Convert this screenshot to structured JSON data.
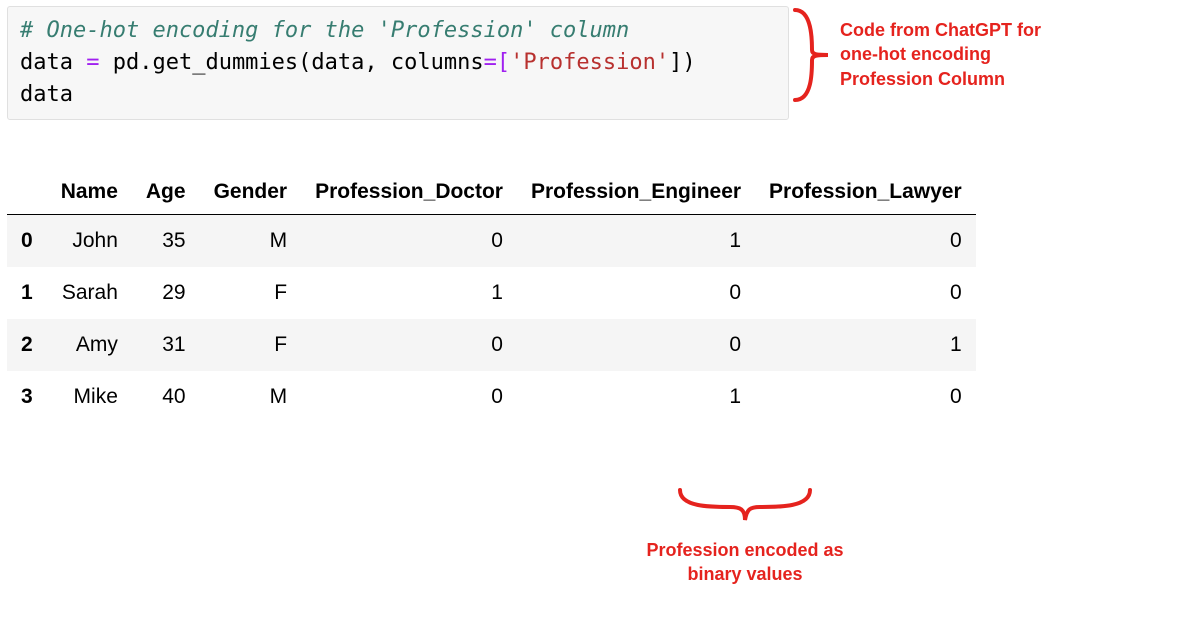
{
  "code": {
    "comment": "# One-hot encoding for the 'Profession' column",
    "line2_id": "data",
    "line2_eq": " = ",
    "line2_call": "pd.get_dummies",
    "line2_lp": "(",
    "line2_arg1": "data",
    "line2_comma": ", ",
    "line2_kw": "columns",
    "line2_eq2": "=[",
    "line2_str": "'Profession'",
    "line2_rp": "])",
    "line3": "data"
  },
  "table": {
    "index_label": "",
    "columns": [
      "Name",
      "Age",
      "Gender",
      "Profession_Doctor",
      "Profession_Engineer",
      "Profession_Lawyer"
    ],
    "rows": [
      {
        "idx": "0",
        "Name": "John",
        "Age": "35",
        "Gender": "M",
        "Profession_Doctor": "0",
        "Profession_Engineer": "1",
        "Profession_Lawyer": "0"
      },
      {
        "idx": "1",
        "Name": "Sarah",
        "Age": "29",
        "Gender": "F",
        "Profession_Doctor": "1",
        "Profession_Engineer": "0",
        "Profession_Lawyer": "0"
      },
      {
        "idx": "2",
        "Name": "Amy",
        "Age": "31",
        "Gender": "F",
        "Profession_Doctor": "0",
        "Profession_Engineer": "0",
        "Profession_Lawyer": "1"
      },
      {
        "idx": "3",
        "Name": "Mike",
        "Age": "40",
        "Gender": "M",
        "Profession_Doctor": "0",
        "Profession_Engineer": "1",
        "Profession_Lawyer": "0"
      }
    ]
  },
  "annotations": {
    "top": "Code from ChatGPT for one-hot encoding Profession Column",
    "bottom": "Profession encoded as binary values"
  }
}
